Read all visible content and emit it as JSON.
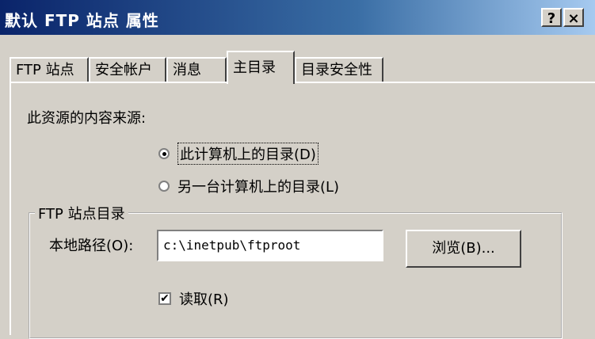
{
  "window": {
    "title": "默认 FTP 站点 属性",
    "help_button": "?",
    "close_button": "×"
  },
  "tabs": [
    {
      "label": "FTP 站点"
    },
    {
      "label": "安全帐户"
    },
    {
      "label": "消息"
    },
    {
      "label": "主目录"
    },
    {
      "label": "目录安全性"
    }
  ],
  "active_tab": "主目录",
  "content_source": {
    "label": "此资源的内容来源:",
    "options": [
      {
        "label": "此计算机上的目录(D)",
        "selected": true
      },
      {
        "label": "另一台计算机上的目录(L)",
        "selected": false
      }
    ]
  },
  "ftp_dir_group": {
    "label": "FTP 站点目录",
    "local_path_label": "本地路径(O):",
    "local_path_value": "c:\\inetpub\\ftproot",
    "browse_button": "浏览(B)...",
    "read_checkbox": {
      "label": "读取(R)",
      "checked": true
    }
  }
}
